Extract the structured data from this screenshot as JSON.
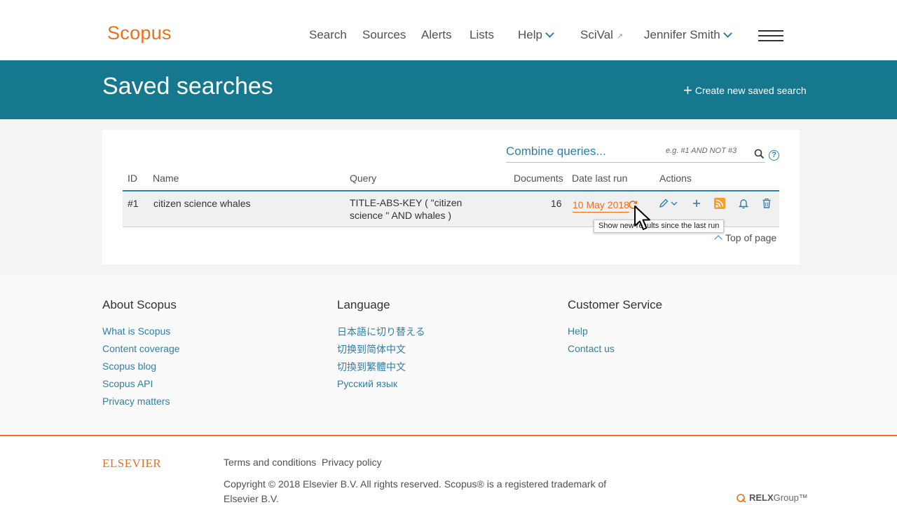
{
  "header": {
    "logo": "Scopus",
    "nav": {
      "search": "Search",
      "sources": "Sources",
      "alerts": "Alerts",
      "lists": "Lists",
      "help": "Help",
      "scival": "SciVal",
      "user": "Jennifer Smith"
    }
  },
  "page": {
    "title": "Saved searches",
    "create_label": "Create new saved search"
  },
  "combine": {
    "label": "Combine queries...",
    "placeholder": "e.g. #1 AND NOT #3"
  },
  "table": {
    "columns": {
      "id": "ID",
      "name": "Name",
      "query": "Query",
      "documents": "Documents",
      "date": "Date last run",
      "actions": "Actions"
    },
    "rows": [
      {
        "id": "#1",
        "name": "citizen science whales",
        "query": "TITLE-ABS-KEY ( \"citizen science \" AND whales )",
        "documents": "16",
        "date": "10 May 2018"
      }
    ]
  },
  "tooltip": "Show new results since the last run",
  "top_of_page": "Top of page",
  "footer": {
    "about": {
      "heading": "About Scopus",
      "links": [
        "What is Scopus",
        "Content coverage",
        "Scopus blog",
        "Scopus API",
        "Privacy matters"
      ]
    },
    "language": {
      "heading": "Language",
      "links": [
        "日本語に切り替える",
        "切换到简体中文",
        "切換到繁體中文",
        "Русский язык"
      ]
    },
    "service": {
      "heading": "Customer Service",
      "links": [
        "Help",
        "Contact us"
      ]
    }
  },
  "bottom": {
    "elsevier": "ELSEVIER",
    "terms": "Terms and conditions",
    "privacy": "Privacy policy",
    "copyright": "Copyright © 2018 Elsevier B.V. All rights reserved. Scopus® is a registered trademark of Elsevier B.V.",
    "relx_prefix": "RELX",
    "relx_suffix": "Group™"
  },
  "colors": {
    "brand_orange": "#e9711c",
    "band_teal": "#16788f",
    "link_blue": "#2e7fa6"
  }
}
